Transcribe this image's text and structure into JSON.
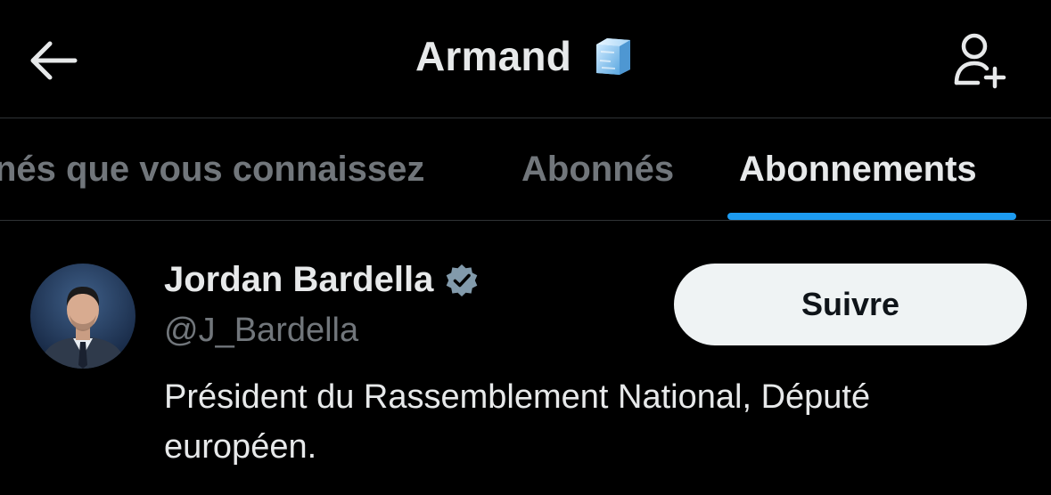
{
  "header": {
    "title": "Armand",
    "title_emoji_icon": "ice-cube-icon",
    "back_icon": "arrow-left-icon",
    "add_user_icon": "add-user-icon"
  },
  "tabs": [
    {
      "label": "Abonnés que vous connaissez",
      "visible_label": "nés que vous connaissez",
      "active": false
    },
    {
      "label": "Abonnés",
      "active": false
    },
    {
      "label": "Abonnements",
      "active": true
    }
  ],
  "colors": {
    "background": "#000000",
    "primary_text": "#e7e9ea",
    "secondary_text": "#71767b",
    "accent": "#1d9bf0",
    "verified_badge": "#829aab",
    "follow_button_bg": "#eff3f4",
    "divider": "#2f3336"
  },
  "user": {
    "name": "Jordan Bardella",
    "verified_icon": "verified-badge-icon",
    "handle": "@J_Bardella",
    "bio": "Président du Rassemblement National, Député européen.",
    "follow_label": "Suivre"
  }
}
